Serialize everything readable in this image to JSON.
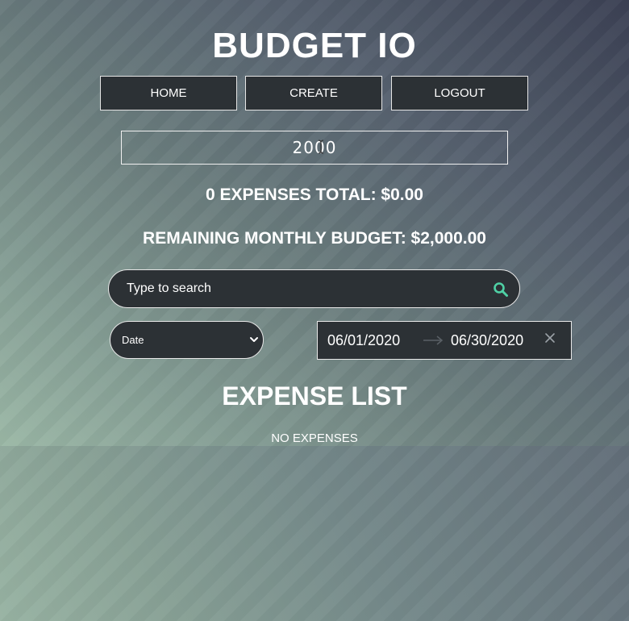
{
  "header": {
    "title": "BUDGET IO"
  },
  "nav": {
    "home": "HOME",
    "create": "CREATE",
    "logout": "LOGOUT"
  },
  "budget": {
    "value": "2000"
  },
  "summary": {
    "expenses_total": "0 EXPENSES TOTAL: $0.00",
    "remaining": "REMAINING MONTHLY BUDGET: $2,000.00"
  },
  "search": {
    "placeholder": "Type to search",
    "icon": "search-icon",
    "icon_color": "#4fd1a5"
  },
  "sort": {
    "selected": "Date"
  },
  "date_range": {
    "start": "06/01/2020",
    "end": "06/30/2020"
  },
  "expense_list": {
    "title": "EXPENSE LIST",
    "empty_text": "NO EXPENSES"
  }
}
